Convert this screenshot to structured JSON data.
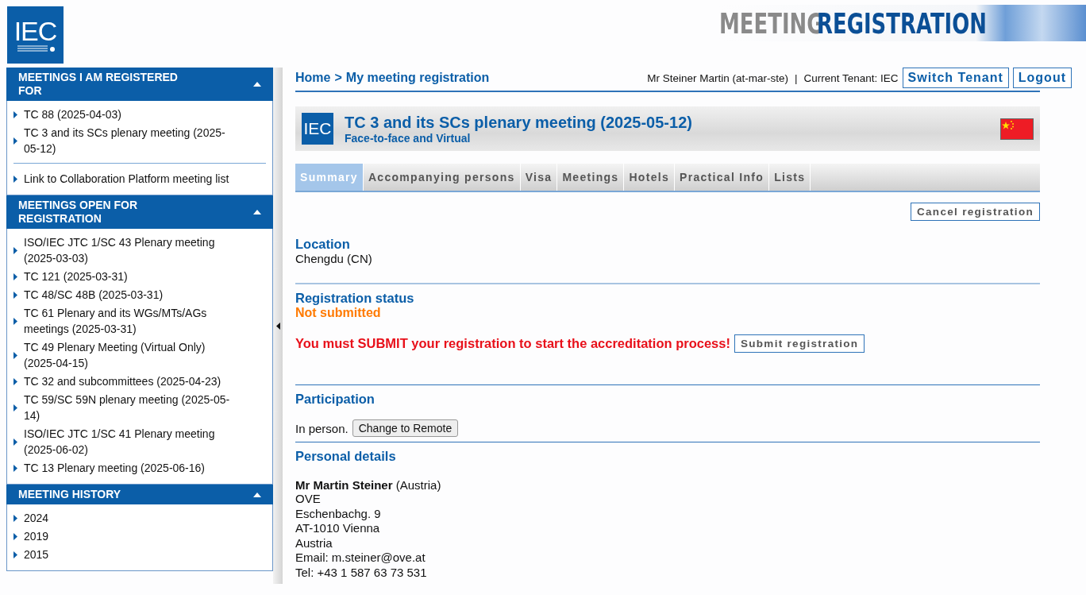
{
  "logo": {
    "text": "IEC"
  },
  "banner": {
    "word_1": "MEETING",
    "word_2": "REGISTRATION"
  },
  "sidebar": {
    "sections": [
      {
        "title": "MEETINGS I AM REGISTERED FOR",
        "expanded": true,
        "groups": [
          [
            "TC 88 (2025-04-03)",
            "TC 3 and its SCs plenary meeting (2025-05-12)"
          ],
          [
            "Link to Collaboration Platform meeting list"
          ]
        ]
      },
      {
        "title": "MEETINGS OPEN FOR REGISTRATION",
        "expanded": true,
        "groups": [
          [
            "ISO/IEC JTC 1/SC 43 Plenary meeting (2025-03-03)",
            "TC 121 (2025-03-31)",
            "TC 48/SC 48B (2025-03-31)",
            "TC 61 Plenary and its WGs/MTs/AGs meetings (2025-03-31)",
            "TC 49 Plenary Meeting (Virtual Only) (2025-04-15)",
            "TC 32 and subcommittees (2025-04-23)",
            "TC 59/SC 59N plenary meeting (2025-05-14)",
            "ISO/IEC JTC 1/SC 41 Plenary meeting (2025-06-02)",
            "TC 13 Plenary meeting (2025-06-16)"
          ]
        ]
      },
      {
        "title": "MEETING HISTORY",
        "expanded": true,
        "groups": [
          [
            "2024",
            "2019",
            "2015"
          ]
        ]
      }
    ]
  },
  "breadcrumb": {
    "items": [
      "Home",
      "My meeting registration"
    ],
    "separator": ">"
  },
  "user": {
    "name": "Mr Steiner Martin (at-mar-ste)",
    "separator": "|",
    "tenant": "Current Tenant: IEC",
    "buttons": [
      "Switch Tenant",
      "Logout"
    ]
  },
  "meeting": {
    "logo": "IEC",
    "title": "TC 3 and its SCs plenary meeting (2025-05-12)",
    "subtitle": "Face-to-face and Virtual"
  },
  "tabs": [
    {
      "label": "Summary",
      "selected": true
    },
    {
      "label": "Accompanying persons",
      "selected": false
    },
    {
      "label": "Visa",
      "selected": false
    },
    {
      "label": "Meetings",
      "selected": false
    },
    {
      "label": "Hotels",
      "selected": false
    },
    {
      "label": "Practical Info",
      "selected": false
    },
    {
      "label": "Lists",
      "selected": false
    }
  ],
  "cancel_button": "Cancel registration",
  "location": {
    "heading": "Location",
    "value": "Chengdu (CN)"
  },
  "registration_status": {
    "heading": "Registration status",
    "value": "Not submitted",
    "warning": "You must SUBMIT your registration to start the accreditation process!",
    "button": "Submit registration"
  },
  "participation": {
    "heading": "Participation",
    "text": "In person.",
    "button": "Change to Remote"
  },
  "personal_details": {
    "heading": "Personal details",
    "name": "**Mr Martin Steiner** (Austria)",
    "lines": [
      "OVE",
      "Eschenbachg. 9",
      "AT-1010 Vienna",
      "Austria",
      "Email: m.steiner@ove.at",
      "Tel: +43 1 587 63 73 531"
    ]
  }
}
